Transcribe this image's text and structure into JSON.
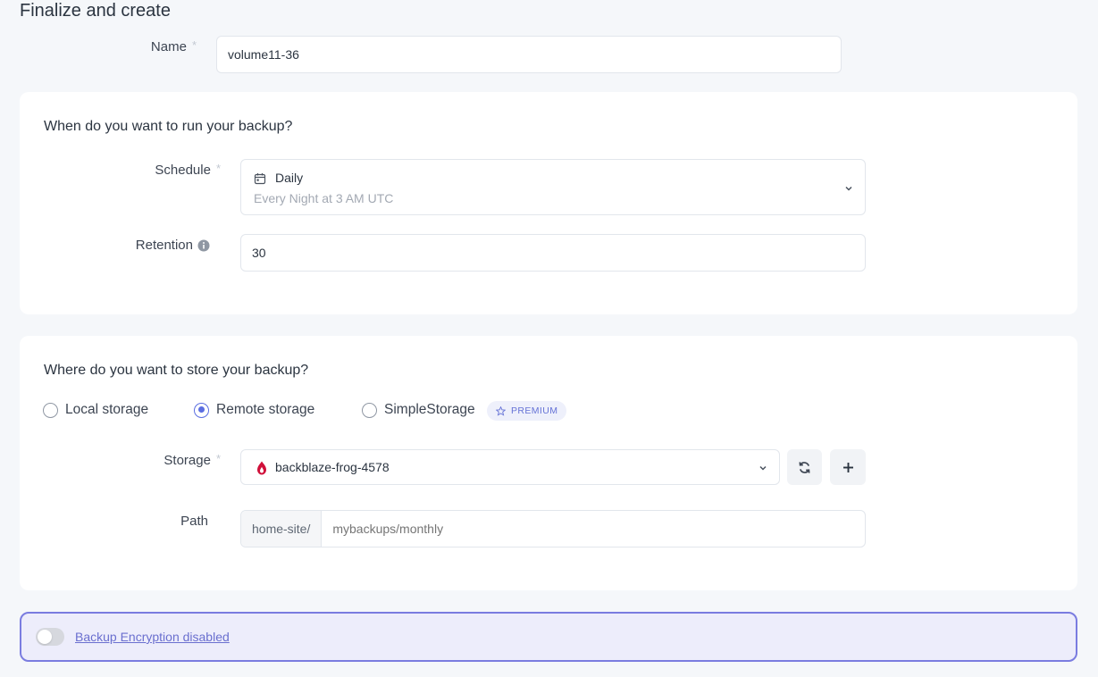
{
  "page": {
    "title": "Finalize and create"
  },
  "name_field": {
    "label": "Name",
    "required_mark": "*",
    "value": "volume11-36"
  },
  "schedule_card": {
    "title": "When do you want to run your backup?",
    "schedule": {
      "label": "Schedule",
      "required_mark": "*",
      "selected": "Daily",
      "description": "Every Night at 3 AM UTC",
      "icon": "calendar-icon"
    },
    "retention": {
      "label": "Retention",
      "value": "30",
      "icon": "info-icon"
    }
  },
  "storage_card": {
    "title": "Where do you want to store your backup?",
    "options": [
      {
        "label": "Local storage",
        "checked": false
      },
      {
        "label": "Remote storage",
        "checked": true
      },
      {
        "label": "SimpleStorage",
        "checked": false
      }
    ],
    "premium_badge": "PREMIUM",
    "storage": {
      "label": "Storage",
      "required_mark": "*",
      "selected": "backblaze-frog-4578",
      "provider_icon": "backblaze-flame-icon"
    },
    "path": {
      "label": "Path",
      "prefix": "home-site/",
      "placeholder": "mybackups/monthly"
    }
  },
  "encryption": {
    "label": "Backup Encryption disabled",
    "enabled": false
  },
  "colors": {
    "accent": "#5b6ee1",
    "encryption_border": "#7a7ce0",
    "backblaze_red": "#d0103a"
  }
}
